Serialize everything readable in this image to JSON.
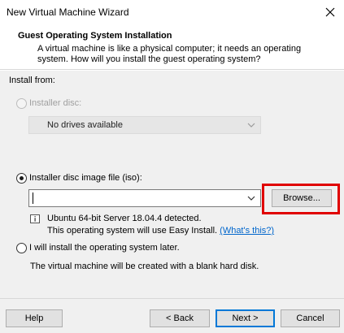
{
  "window": {
    "title": "New Virtual Machine Wizard",
    "close_icon": "close-icon"
  },
  "header": {
    "title": "Guest Operating System Installation",
    "description": "A virtual machine is like a physical computer; it needs an operating system. How will you install the guest operating system?"
  },
  "install_from": {
    "label": "Install from:",
    "installer_disc": {
      "label": "Installer disc:",
      "selected": false,
      "enabled": false,
      "dropdown_value": "No drives available"
    },
    "iso": {
      "label": "Installer disc image file (iso):",
      "selected": true,
      "value": "",
      "browse_label": "Browse...",
      "detected_text": "Ubuntu 64-bit Server 18.04.4 detected.",
      "easy_install_text": "This operating system will use Easy Install.",
      "whats_this_link": "(What's this?)",
      "info_icon": "info-icon"
    },
    "later": {
      "label": "I will install the operating system later.",
      "selected": false,
      "description": "The virtual machine will be created with a blank hard disk."
    }
  },
  "footer": {
    "help_label": "Help",
    "back_label": "< Back",
    "next_label": "Next >",
    "cancel_label": "Cancel"
  },
  "colors": {
    "highlight": "#e00000",
    "link": "#0066cc",
    "accent": "#0078d7"
  }
}
